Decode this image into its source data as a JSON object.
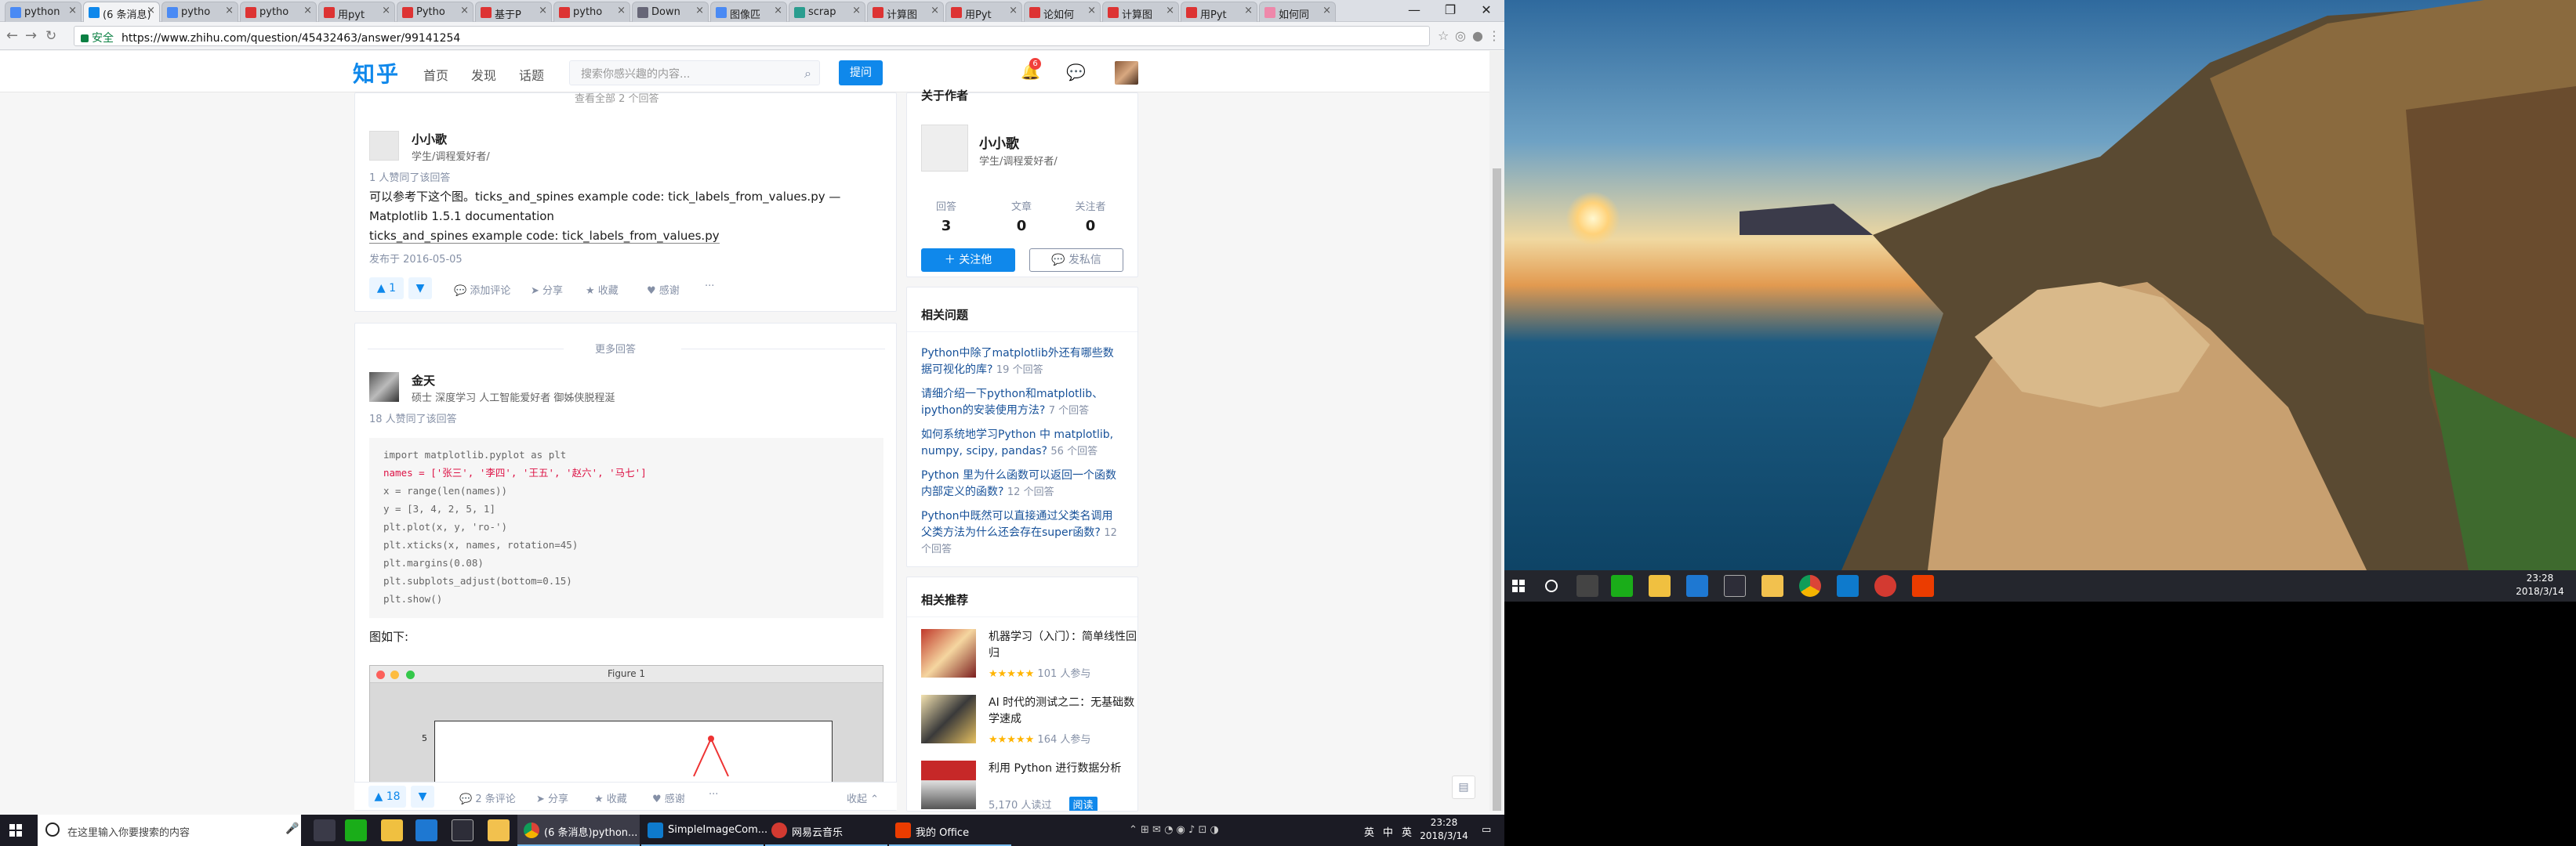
{
  "browser": {
    "tabs": [
      "python",
      "(6 条消息)",
      "pytho",
      "pytho",
      "用pyt",
      "Pytho",
      "基于P",
      "pytho",
      "Down",
      "图像匹",
      "scrap",
      "计算图",
      "用Pyt",
      "论如何",
      "计算图",
      "用Pyt",
      "如何同"
    ],
    "active_tab": 1,
    "secure_label": "安全",
    "url": "https://www.zhihu.com/question/45432463/answer/99141254",
    "window_controls": [
      "—",
      "❐",
      "✕"
    ]
  },
  "header": {
    "logo": "知乎",
    "nav": [
      "首页",
      "发现",
      "话题"
    ],
    "search_placeholder": "搜索你感兴趣的内容...",
    "ask_label": "提问",
    "notification_count": "6"
  },
  "top_cut": "查看全部 2 个回答",
  "answers": [
    {
      "author": "小小歌",
      "bio": "学生/调程爱好者/",
      "likes": "1 人赞同了该回答",
      "text": "可以参考下这个图。ticks_and_spines example code: tick_labels_from_values.py — Matplotlib 1.5.1 documentation",
      "link": "ticks_and_spines example code: tick_labels_from_values.py",
      "date": "发布于 2016-05-05",
      "votes": "1",
      "actions": [
        "添加评论",
        "分享",
        "收藏",
        "感谢"
      ],
      "more": "···"
    }
  ],
  "more_answers": "更多回答",
  "answer2": {
    "author": "金天",
    "bio": "硕士 深度学习 人工智能爱好者 御姊侠脱程涎",
    "likes": "18 人赞同了该回答",
    "code": [
      "import matplotlib.pyplot as plt",
      "names = ['张三', '李四', '王五', '赵六', '马七']",
      "x = range(len(names))",
      "y = [3, 4, 2, 5, 1]",
      "plt.plot(x, y, 'ro-')",
      "plt.xticks(x, names, rotation=45)",
      "plt.margins(0.08)",
      "plt.subplots_adjust(bottom=0.15)",
      "plt.show()"
    ],
    "after": "图如下:",
    "figure_title": "Figure 1",
    "figure_tick": "5",
    "votes": "18",
    "actions": [
      "2 条评论",
      "分享",
      "收藏",
      "感谢"
    ],
    "more": "···",
    "collapse": "收起"
  },
  "sidebar": {
    "about_header": "关于作者",
    "author": "小小歌",
    "bio": "学生/调程爱好者/",
    "stats": [
      {
        "label": "回答",
        "value": "3"
      },
      {
        "label": "文章",
        "value": "0"
      },
      {
        "label": "关注者",
        "value": "0"
      }
    ],
    "follow_label": "关注他",
    "message_label": "发私信",
    "related_q_header": "相关问题",
    "related": [
      {
        "q": "Python中除了matplotlib外还有哪些数据可视化的库?",
        "c": "19 个回答"
      },
      {
        "q": "请细介绍一下python和matplotlib、ipython的安装使用方法?",
        "c": "7 个回答"
      },
      {
        "q": "如何系统地学习Python 中 matplotlib, numpy, scipy, pandas?",
        "c": "56 个回答"
      },
      {
        "q": "Python 里为什么函数可以返回一个函数内部定义的函数?",
        "c": "12 个回答"
      },
      {
        "q": "Python中既然可以直接通过父类名调用父类方法为什么还会存在super函数?",
        "c": "12 个回答"
      }
    ],
    "rec_header": "相关推荐",
    "recs": [
      {
        "t": "机器学习（入门）：简单线性回归",
        "stars": "★★★★★",
        "c": "101 人参与"
      },
      {
        "t": "AI 时代的测试之二：无基础数学速成",
        "stars": "★★★★★",
        "c": "164 人参与"
      },
      {
        "t": "利用 Python 进行数据分析",
        "stars": "",
        "c": "5,170 人读过",
        "tag": "阅读"
      }
    ]
  },
  "taskbar": {
    "search_placeholder": "在这里输入你要搜索的内容",
    "apps": [
      "(6 条消息)python...",
      "SimpleImageCom...",
      "网易云音乐",
      "我的 Office"
    ],
    "tray": [
      "英",
      "中",
      "英"
    ],
    "time": "23:28",
    "date": "2018/3/14"
  },
  "right_taskbar": {
    "time": "23:28",
    "date": "2018/3/14"
  }
}
